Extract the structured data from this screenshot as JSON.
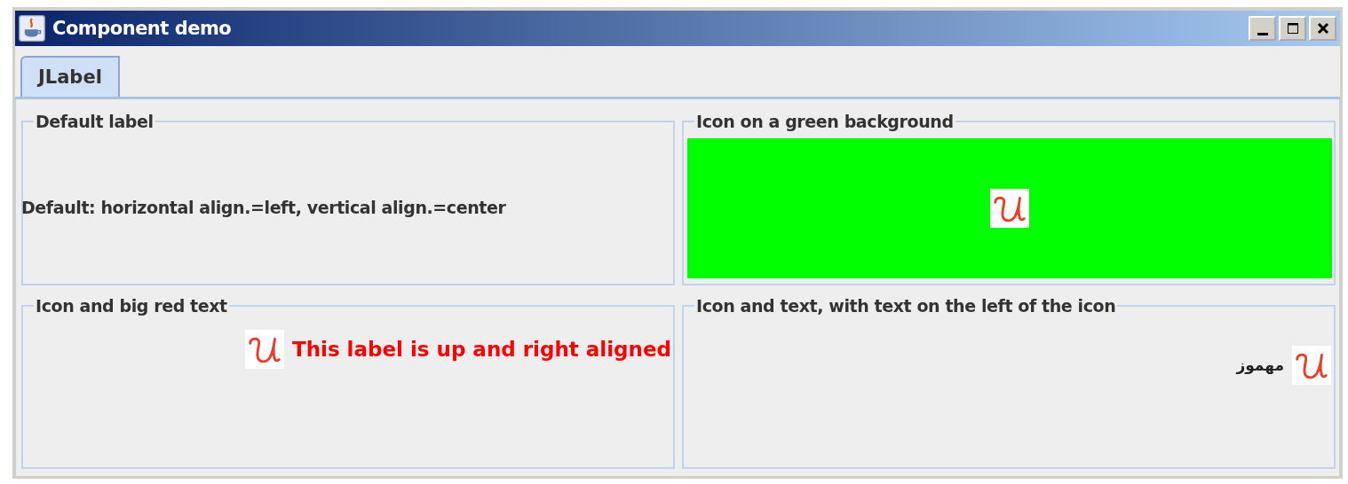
{
  "window": {
    "title": "Component demo"
  },
  "tabs": [
    {
      "label": "JLabel",
      "selected": true
    }
  ],
  "panels": [
    {
      "title": "Default label",
      "kind": "text",
      "text": "Default: horizontal align.=left, vertical align.=center"
    },
    {
      "title": "Icon on a green background",
      "kind": "green-icon"
    },
    {
      "title": "Icon and big red text",
      "kind": "icon-text",
      "text": "This label is up and right aligned"
    },
    {
      "title": "Icon and text, with text on the left of the icon",
      "kind": "text-icon",
      "text": "مهموز"
    }
  ]
}
